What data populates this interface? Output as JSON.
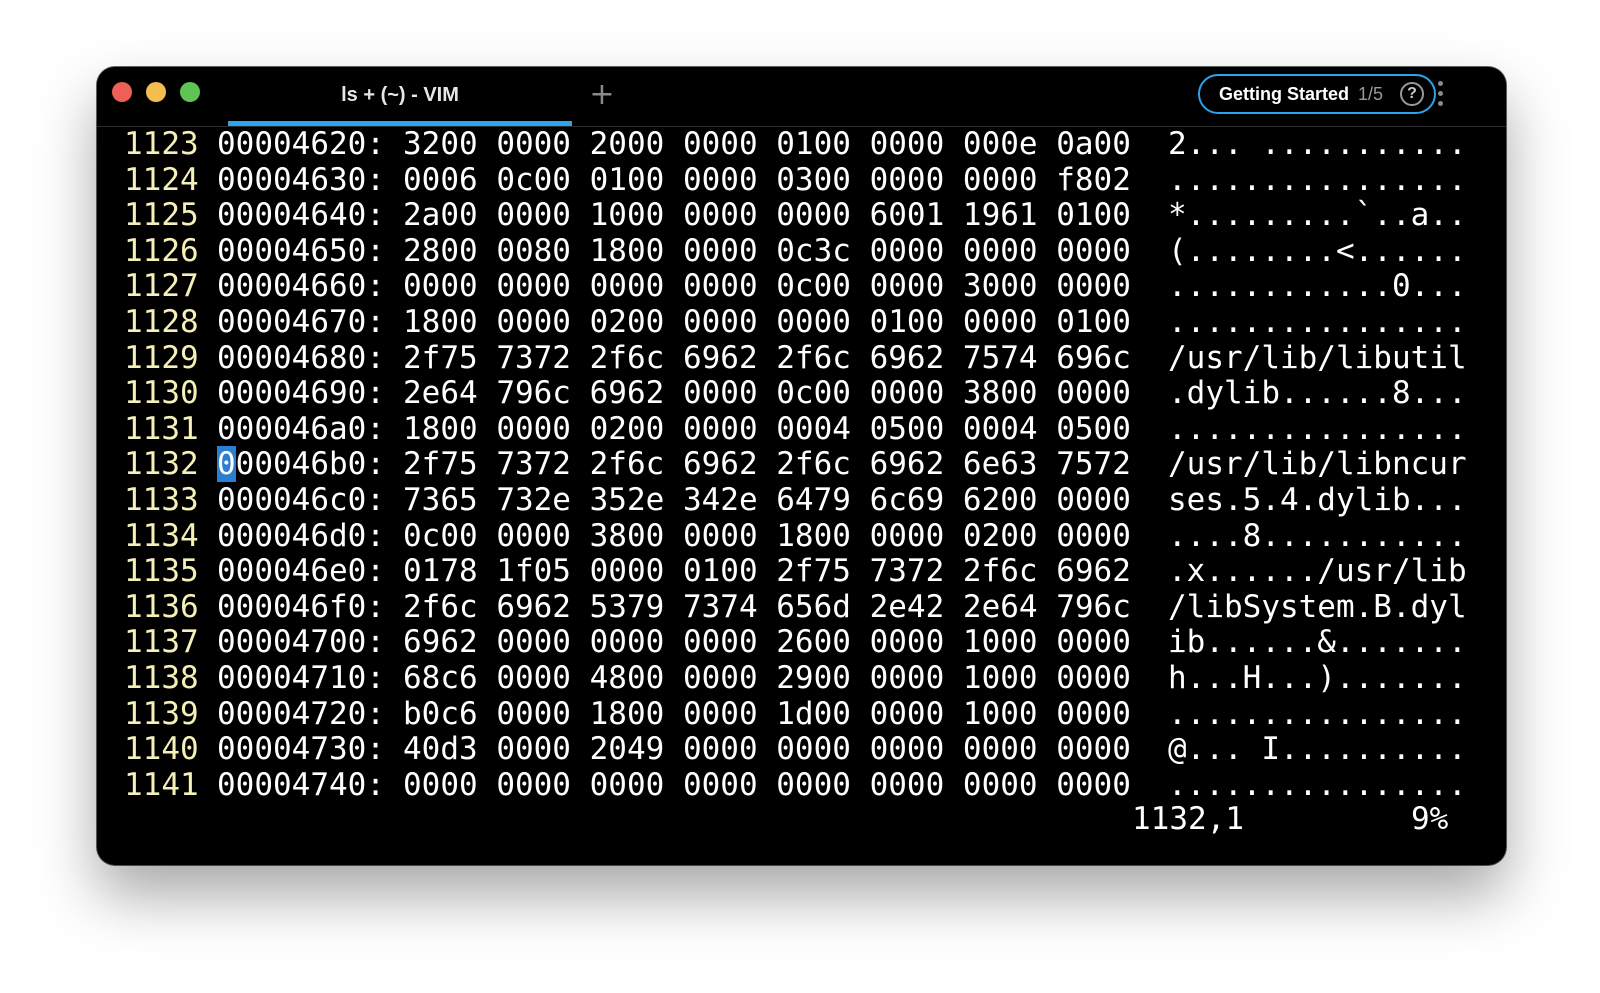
{
  "window": {
    "tab_title": "ls + (~) - VIM",
    "new_tab_glyph": "+",
    "getting_started": {
      "label": "Getting Started",
      "progress": "1/5",
      "help_glyph": "?"
    }
  },
  "editor": {
    "rows": [
      {
        "line": "1123",
        "addr": "00004620:",
        "hex": "3200 0000 2000 0000 0100 0000 000e 0a00",
        "ascii": "2... ..........."
      },
      {
        "line": "1124",
        "addr": "00004630:",
        "hex": "0006 0c00 0100 0000 0300 0000 0000 f802",
        "ascii": "................"
      },
      {
        "line": "1125",
        "addr": "00004640:",
        "hex": "2a00 0000 1000 0000 0000 6001 1961 0100",
        "ascii": "*.........`..a.."
      },
      {
        "line": "1126",
        "addr": "00004650:",
        "hex": "2800 0080 1800 0000 0c3c 0000 0000 0000",
        "ascii": "(........<......"
      },
      {
        "line": "1127",
        "addr": "00004660:",
        "hex": "0000 0000 0000 0000 0c00 0000 3000 0000",
        "ascii": "............0..."
      },
      {
        "line": "1128",
        "addr": "00004670:",
        "hex": "1800 0000 0200 0000 0000 0100 0000 0100",
        "ascii": "................"
      },
      {
        "line": "1129",
        "addr": "00004680:",
        "hex": "2f75 7372 2f6c 6962 2f6c 6962 7574 696c",
        "ascii": "/usr/lib/libutil"
      },
      {
        "line": "1130",
        "addr": "00004690:",
        "hex": "2e64 796c 6962 0000 0c00 0000 3800 0000",
        "ascii": ".dylib......8..."
      },
      {
        "line": "1131",
        "addr": "000046a0:",
        "hex": "1800 0000 0200 0000 0004 0500 0004 0500",
        "ascii": "................"
      },
      {
        "line": "1132",
        "addr": "000046b0:",
        "hex": "2f75 7372 2f6c 6962 2f6c 6962 6e63 7572",
        "ascii": "/usr/lib/libncur"
      },
      {
        "line": "1133",
        "addr": "000046c0:",
        "hex": "7365 732e 352e 342e 6479 6c69 6200 0000",
        "ascii": "ses.5.4.dylib..."
      },
      {
        "line": "1134",
        "addr": "000046d0:",
        "hex": "0c00 0000 3800 0000 1800 0000 0200 0000",
        "ascii": "....8..........."
      },
      {
        "line": "1135",
        "addr": "000046e0:",
        "hex": "0178 1f05 0000 0100 2f75 7372 2f6c 6962",
        "ascii": ".x....../usr/lib"
      },
      {
        "line": "1136",
        "addr": "000046f0:",
        "hex": "2f6c 6962 5379 7374 656d 2e42 2e64 796c",
        "ascii": "/libSystem.B.dyl"
      },
      {
        "line": "1137",
        "addr": "00004700:",
        "hex": "6962 0000 0000 0000 2600 0000 1000 0000",
        "ascii": "ib......&......."
      },
      {
        "line": "1138",
        "addr": "00004710:",
        "hex": "68c6 0000 4800 0000 2900 0000 1000 0000",
        "ascii": "h...H...)......."
      },
      {
        "line": "1139",
        "addr": "00004720:",
        "hex": "b0c6 0000 1800 0000 1d00 0000 1000 0000",
        "ascii": "................"
      },
      {
        "line": "1140",
        "addr": "00004730:",
        "hex": "40d3 0000 2049 0000 0000 0000 0000 0000",
        "ascii": "@... I.........."
      },
      {
        "line": "1141",
        "addr": "00004740:",
        "hex": "0000 0000 0000 0000 0000 0000 0000 0000",
        "ascii": "................"
      }
    ],
    "cursor_line": "1132",
    "status": {
      "position": "1132,1",
      "percent": "9%"
    }
  },
  "colors": {
    "background": "#000000",
    "line_number": "#f4f0b8",
    "accent": "#2aa4ec",
    "cursor": "#2a7fd4",
    "close": "#ed5f57",
    "minimize": "#f4bd4f",
    "maximize": "#5fc454"
  }
}
